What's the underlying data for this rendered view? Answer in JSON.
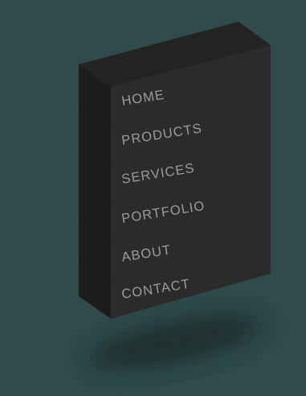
{
  "menu": {
    "items": [
      {
        "label": "HOME"
      },
      {
        "label": "PRODUCTS"
      },
      {
        "label": "SERVICES"
      },
      {
        "label": "PORTFOLIO"
      },
      {
        "label": "ABOUT"
      },
      {
        "label": "CONTACT"
      }
    ]
  },
  "colors": {
    "background": "#2f4b4b",
    "front_face": "#2a2b2a",
    "top_face": "#232322",
    "side_face": "#1c1c1c",
    "menu_text": "#9c9c9c"
  }
}
